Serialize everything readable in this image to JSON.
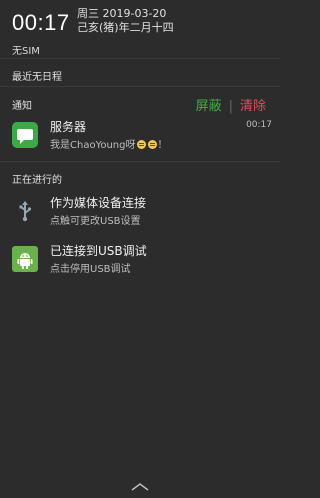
{
  "status": {
    "time": "00:17",
    "date_weekday": "周三 2019-03-20",
    "date_lunar": "己亥(猪)年二月十四",
    "sim": "无SIM"
  },
  "schedule": {
    "label": "最近无日程"
  },
  "notifications": {
    "header": "通知",
    "mute_label": "屏蔽",
    "clear_label": "清除",
    "items": [
      {
        "title": "服务器",
        "text": "我是ChaoYoung呀",
        "trailing": "！",
        "time": "00:17",
        "icon": "message-icon"
      }
    ]
  },
  "ongoing": {
    "header": "正在进行的",
    "items": [
      {
        "title": "作为媒体设备连接",
        "text": "点触可更改USB设置",
        "icon": "usb-icon"
      },
      {
        "title": "已连接到USB调试",
        "text": "点击停用USB调试",
        "icon": "android-debug-icon"
      }
    ]
  },
  "colors": {
    "background": "#2c2c2c",
    "accent_green": "#3daf45",
    "accent_red": "#d8505a"
  }
}
